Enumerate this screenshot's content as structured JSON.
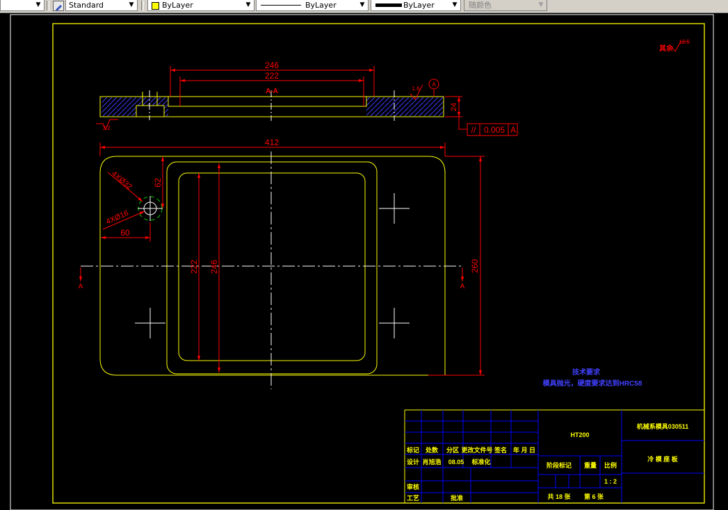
{
  "toolbar": {
    "text_style": "Standard",
    "layer": "ByLayer",
    "linetype": "ByLayer",
    "lineweight": "ByLayer",
    "plot_style": "随颜色",
    "arrow": "▼"
  },
  "colors": {
    "background": "#000000",
    "border": "#ffff00",
    "dimension": "#ff0000",
    "outline": "#ffff00",
    "centerline": "#ffffff",
    "hatch": "#3b3bff",
    "table_lines": "#0000ff",
    "table_text": "#ffff00",
    "guide": "#00cc00"
  },
  "drawing": {
    "dims": {
      "d246_top": "246",
      "d222_top": "222",
      "section": "A-A",
      "d412": "412",
      "d24": "24",
      "d62": "62",
      "d60": "60",
      "d222_v": "222",
      "d246_v": "246",
      "d260": "260",
      "holes_large": "4XØ32",
      "holes_small": "4XØ16",
      "section_left": "A",
      "section_right": "A"
    },
    "tolerance": {
      "symbol": "//",
      "value": "0.005",
      "datum": "A"
    },
    "roughness": {
      "left": "3.2",
      "right": "1.6",
      "corner_label": "其余",
      "corner_value": "12.5"
    },
    "tech_req": {
      "title": "技术要求",
      "line1": "模具抛光，硬度要求达到HRC58"
    },
    "title_block": {
      "material": "HT200",
      "company": "机械系模具030511",
      "part_name": "冷 模 座 板",
      "h_biaoji": "标记",
      "h_chushu": "处数",
      "h_fenqu": "分区",
      "h_gengai": "更改文件号",
      "h_qianming": "签名",
      "h_riqi": "年 月 日",
      "r_sheji": "设计",
      "r_name": "肖旭浩",
      "r_date": "08.05",
      "r_biaozhun": "标准化",
      "r_shenhe": "审核",
      "r_gongyi": "工艺",
      "r_pizhun": "批准",
      "jieduan": "阶段标记",
      "zhongliang": "重量",
      "bili": "比例",
      "scale": "1 : 2",
      "total": "共 18 张",
      "sheet": "第 6 张"
    }
  }
}
